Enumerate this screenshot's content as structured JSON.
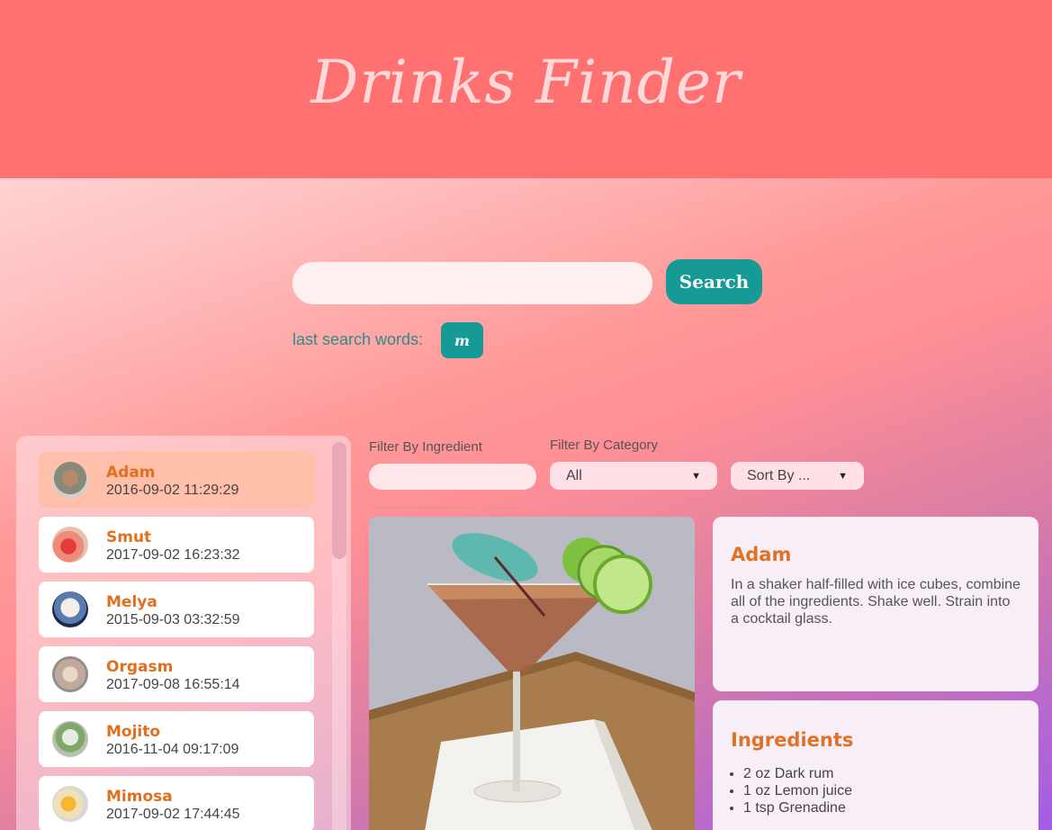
{
  "app": {
    "title": "Drinks Finder"
  },
  "search": {
    "placeholder": "",
    "value": "",
    "button_label": "Search"
  },
  "history": {
    "label": "last search words:",
    "chips": [
      "m"
    ]
  },
  "filters": {
    "ingredient_label": "Filter By Ingredient",
    "ingredient_value": "",
    "category_label": "Filter By Category",
    "category_value": "All",
    "sort_value": "Sort By ..."
  },
  "drinks": [
    {
      "name": "Adam",
      "date": "2016-09-02 11:29:29",
      "selected": true
    },
    {
      "name": "Smut",
      "date": "2017-09-02 16:23:32"
    },
    {
      "name": "Melya",
      "date": "2015-09-03 03:32:59"
    },
    {
      "name": "Orgasm",
      "date": "2017-09-08 16:55:14"
    },
    {
      "name": "Mojito",
      "date": "2016-11-04 09:17:09"
    },
    {
      "name": "Mimosa",
      "date": "2017-09-02 17:44:45"
    }
  ],
  "detail": {
    "name": "Adam",
    "instructions": "In a shaker half-filled with ice cubes, combine all of the ingredients. Shake well. Strain into a cocktail glass.",
    "ingredients_title": "Ingredients",
    "ingredients": [
      "2 oz Dark rum",
      "1 oz Lemon juice",
      "1 tsp Grenadine"
    ]
  },
  "colors": {
    "header": "#ff7070",
    "accent": "#159a96",
    "drink_name": "#e0701f",
    "selected_item": "#ffbfa8"
  }
}
